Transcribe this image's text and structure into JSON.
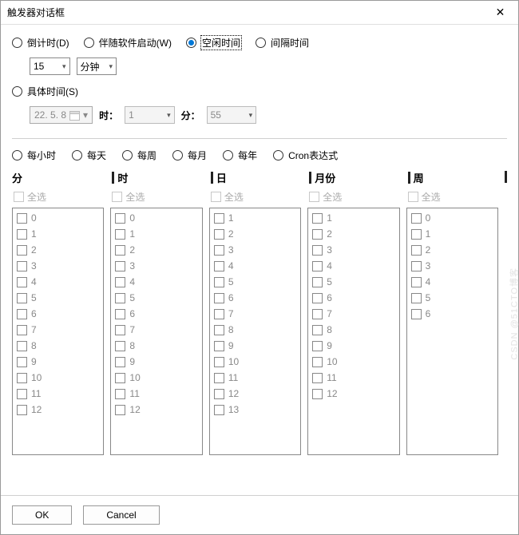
{
  "title": "触发器对话框",
  "top_radios": {
    "countdown": "倒计时(D)",
    "with_software": "伴随软件启动(W)",
    "idle_time": "空闲时间",
    "interval_time": "间隔时间"
  },
  "selected_top": "idle_time",
  "interval_select": {
    "value": "15",
    "unit": "分钟"
  },
  "specific_time_label": "具体时间(S)",
  "date_value": "22. 5. 8",
  "hour_label": "时：",
  "hour_value": "1",
  "minute_label": "分：",
  "minute_value": "55",
  "freq_radios": {
    "hourly": "每小时",
    "daily": "每天",
    "weekly": "每周",
    "monthly": "每月",
    "yearly": "每年",
    "cron": "Cron表达式"
  },
  "select_all": "全选",
  "columns": {
    "minute": {
      "label": "分",
      "items": [
        "0",
        "1",
        "2",
        "3",
        "4",
        "5",
        "6",
        "7",
        "8",
        "9",
        "10",
        "11",
        "12"
      ]
    },
    "hour": {
      "label": "时",
      "items": [
        "0",
        "1",
        "2",
        "3",
        "4",
        "5",
        "6",
        "7",
        "8",
        "9",
        "10",
        "11",
        "12"
      ]
    },
    "day": {
      "label": "日",
      "items": [
        "1",
        "2",
        "3",
        "4",
        "5",
        "6",
        "7",
        "8",
        "9",
        "10",
        "11",
        "12",
        "13"
      ]
    },
    "month": {
      "label": "月份",
      "items": [
        "1",
        "2",
        "3",
        "4",
        "5",
        "6",
        "7",
        "8",
        "9",
        "10",
        "11",
        "12"
      ]
    },
    "week": {
      "label": "周",
      "items": [
        "0",
        "1",
        "2",
        "3",
        "4",
        "5",
        "6"
      ]
    }
  },
  "buttons": {
    "ok": "OK",
    "cancel": "Cancel"
  },
  "watermark": "CSDN @51CTO博客"
}
